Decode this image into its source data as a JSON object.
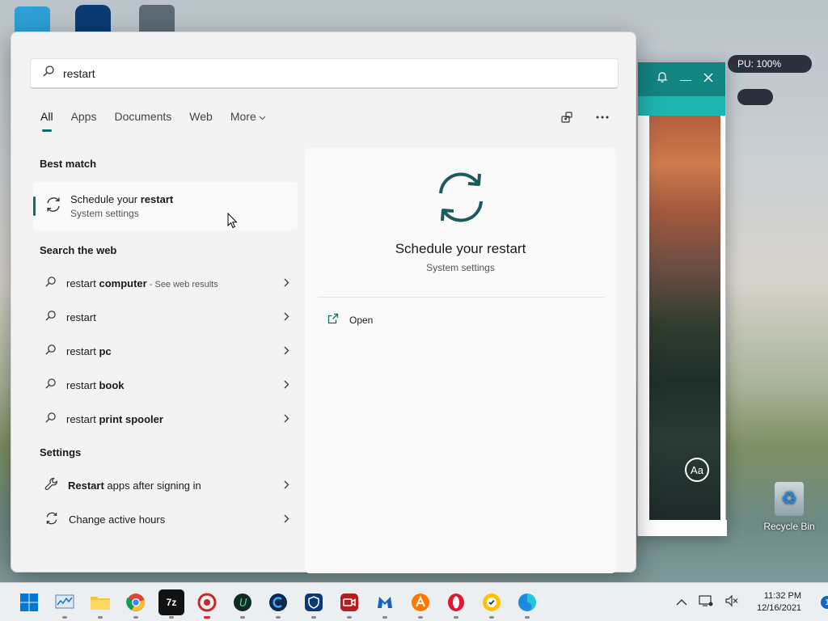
{
  "desktop": {
    "right_window_aa": "Aa",
    "tray_pill_text": "PU: 100%",
    "recycle_bin_label": "Recycle Bin"
  },
  "search": {
    "query": "restart",
    "tabs": [
      {
        "label": "All",
        "active": true
      },
      {
        "label": "Apps"
      },
      {
        "label": "Documents"
      },
      {
        "label": "Web"
      },
      {
        "label": "More"
      }
    ]
  },
  "sections": {
    "best_match": "Best match",
    "search_web": "Search the web",
    "settings": "Settings"
  },
  "best_match": {
    "title_prefix": "Schedule your ",
    "title_bold": "restart",
    "subtitle": "System settings"
  },
  "web_results": [
    {
      "plain": "restart ",
      "bold": "computer",
      "hint": " - See web results"
    },
    {
      "plain": "restart",
      "bold": "",
      "hint": ""
    },
    {
      "plain": "restart ",
      "bold": "pc",
      "hint": ""
    },
    {
      "plain": "restart ",
      "bold": "book",
      "hint": ""
    },
    {
      "plain": "restart ",
      "bold": "print spooler",
      "hint": ""
    }
  ],
  "settings_results": [
    {
      "bold": "Restart",
      "plain": " apps after signing in"
    },
    {
      "bold": "",
      "plain": "Change active hours"
    }
  ],
  "preview": {
    "title": "Schedule your restart",
    "subtitle": "System settings",
    "open_label": "Open"
  },
  "taskbar": {
    "time": "11:32 PM",
    "date": "12/16/2021",
    "notification_count": "1"
  },
  "colors": {
    "accent": "#0f6b6e",
    "panel_bg": "#f3f3f3"
  }
}
